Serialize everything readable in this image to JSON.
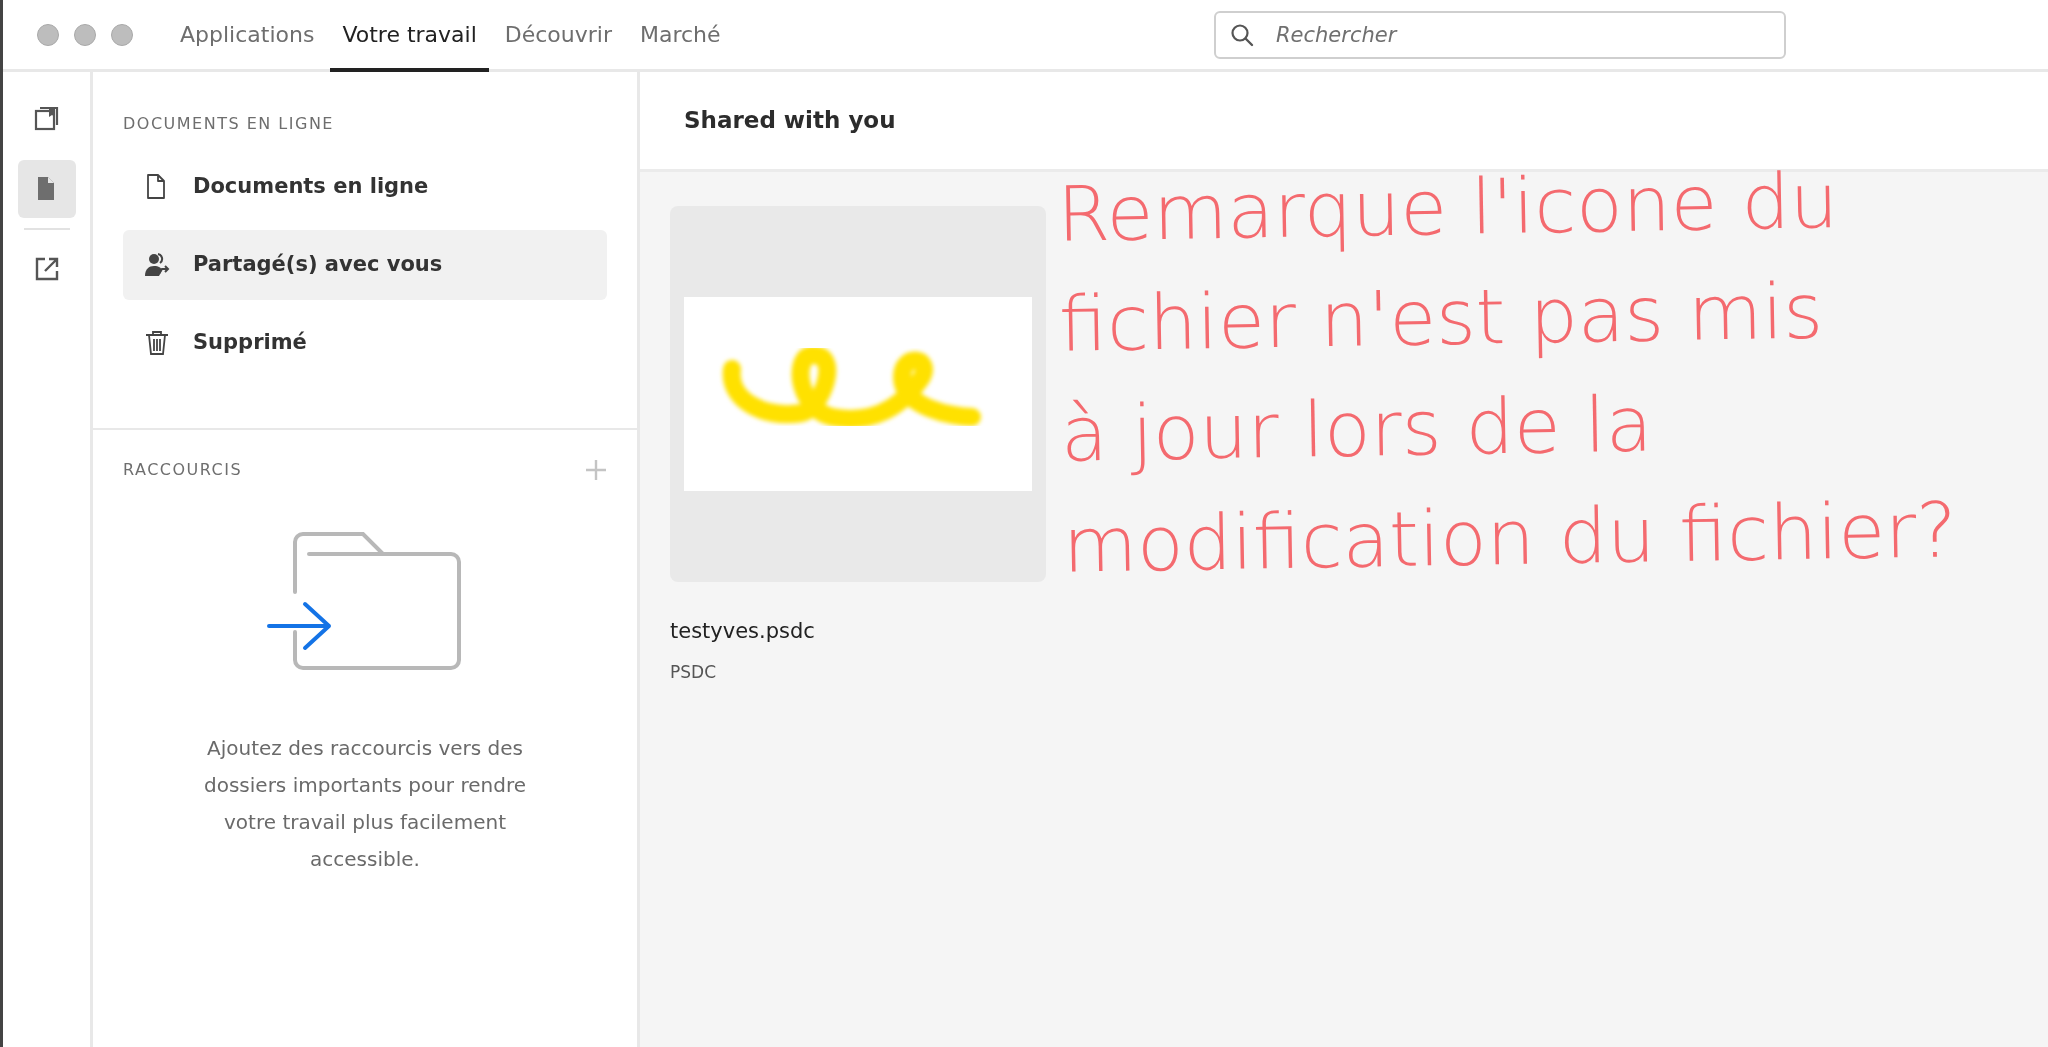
{
  "tabs": [
    {
      "label": "Applications",
      "selected": false
    },
    {
      "label": "Votre travail",
      "selected": true
    },
    {
      "label": "Découvrir",
      "selected": false
    },
    {
      "label": "Marché",
      "selected": false
    }
  ],
  "search": {
    "placeholder": "Rechercher"
  },
  "rail": [
    {
      "kind": "library",
      "selected": false
    },
    {
      "kind": "document",
      "selected": true
    },
    {
      "kind": "external",
      "selected": false
    }
  ],
  "sidebar": {
    "heading": "DOCUMENTS EN LIGNE",
    "items": [
      {
        "label": "Documents en ligne",
        "kind": "document",
        "selected": false
      },
      {
        "label": "Partagé(s) avec vous",
        "kind": "shared",
        "selected": true
      },
      {
        "label": "Supprimé",
        "kind": "trash",
        "selected": false
      }
    ]
  },
  "shortcuts": {
    "heading": "RACCOURCIS",
    "message": "Ajoutez des raccourcis vers des dossiers importants pour rendre votre travail plus facilement accessible."
  },
  "main": {
    "title": "Shared with you",
    "files": [
      {
        "name": "testyves.psdc",
        "type": "PSDC"
      }
    ]
  },
  "annotation": {
    "lines": [
      "Remarque l'icone du",
      "fichier n'est pas mis",
      "à jour lors de la",
      "modification du fichier?"
    ]
  }
}
